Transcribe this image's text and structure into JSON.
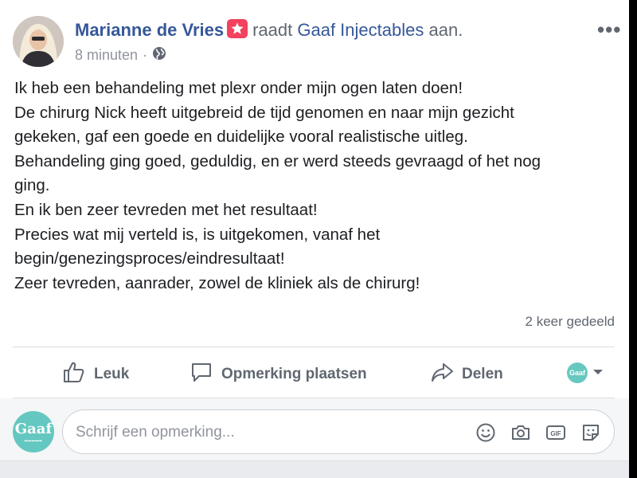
{
  "post": {
    "author_name": "Marianne de Vries",
    "recommends_text": "raadt",
    "page_name": "Gaaf Injectables",
    "suffix_text": "aan.",
    "timestamp": "8 minuten",
    "more_label": "•••",
    "body_lines": [
      "Ik heb een behandeling met plexr onder mijn ogen laten doen!",
      "De chirurg Nick heeft uitgebreid de tijd genomen en naar mijn gezicht",
      "gekeken, gaf een goede en duidelijke vooral realistische uitleg.",
      "Behandeling ging goed, geduldig, en er werd steeds gevraagd of het nog",
      "ging.",
      "En ik ben zeer tevreden met het resultaat!",
      "Precies wat mij verteld is, is uitgekomen, vanaf het",
      "begin/genezingsproces/eindresultaat!",
      "Zeer tevreden, aanrader, zowel de kliniek als de chirurg!"
    ],
    "shares_text": "2 keer gedeeld"
  },
  "actions": {
    "like_label": "Leuk",
    "comment_label": "Opmerking plaatsen",
    "share_label": "Delen",
    "audience_avatar_text": "Gaaf"
  },
  "composer": {
    "avatar_text": "Gaaf",
    "placeholder": "Schrijf een opmerking...",
    "icons": [
      "emoji-icon",
      "camera-icon",
      "gif-icon",
      "sticker-icon"
    ],
    "gif_text": "GIF"
  },
  "colors": {
    "link": "#365899",
    "muted": "#606770",
    "meta": "#90949c",
    "badge": "#f3425f",
    "teal": "#64c8c1"
  }
}
